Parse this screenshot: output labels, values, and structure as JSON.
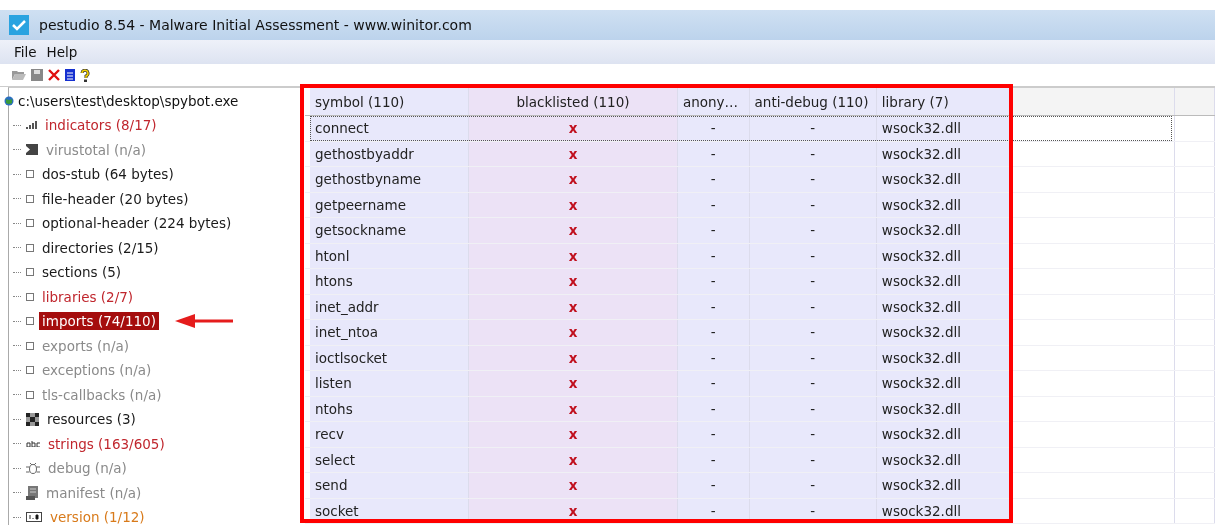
{
  "window": {
    "title": "pestudio 8.54 - Malware Initial Assessment - www.winitor.com"
  },
  "menu": [
    "File",
    "Help"
  ],
  "toolbar": [
    {
      "kind": "open"
    },
    {
      "kind": "save"
    },
    {
      "kind": "close"
    },
    {
      "kind": "clipboard"
    },
    {
      "kind": "help"
    }
  ],
  "tree": {
    "root": "c:\\users\\test\\desktop\\spybot.exe",
    "items": [
      {
        "label": "indicators (8/17)",
        "kind": "chart",
        "color": "#c0262d",
        "selected": false
      },
      {
        "label": "virustotal (n/a)",
        "kind": "virustotal",
        "color": "#8a8a8a",
        "selected": false
      },
      {
        "label": "dos-stub (64 bytes)",
        "kind": "node",
        "color": "#1a1a1a",
        "selected": false
      },
      {
        "label": "file-header (20 bytes)",
        "kind": "node",
        "color": "#1a1a1a",
        "selected": false
      },
      {
        "label": "optional-header (224 bytes)",
        "kind": "node",
        "color": "#1a1a1a",
        "selected": false
      },
      {
        "label": "directories (2/15)",
        "kind": "node",
        "color": "#1a1a1a",
        "selected": false
      },
      {
        "label": "sections (5)",
        "kind": "node",
        "color": "#1a1a1a",
        "selected": false
      },
      {
        "label": "libraries (2/7)",
        "kind": "node",
        "color": "#c0262d",
        "selected": false
      },
      {
        "label": "imports (74/110)",
        "kind": "node",
        "color": "#a50d0d",
        "selected": true
      },
      {
        "label": "exports (n/a)",
        "kind": "node",
        "color": "#8a8a8a",
        "selected": false
      },
      {
        "label": "exceptions (n/a)",
        "kind": "node",
        "color": "#8a8a8a",
        "selected": false
      },
      {
        "label": "tls-callbacks (n/a)",
        "kind": "node",
        "color": "#8a8a8a",
        "selected": false
      },
      {
        "label": "resources (3)",
        "kind": "resources",
        "color": "#1a1a1a",
        "selected": false
      },
      {
        "label": "strings (163/605)",
        "kind": "strings",
        "color": "#c0262d",
        "selected": false
      },
      {
        "label": "debug (n/a)",
        "kind": "debug",
        "color": "#8a8a8a",
        "selected": false
      },
      {
        "label": "manifest (n/a)",
        "kind": "manifest",
        "color": "#8a8a8a",
        "selected": false
      },
      {
        "label": "version (1/12)",
        "kind": "version",
        "color": "#d87a1a",
        "selected": false
      }
    ]
  },
  "table": {
    "columns": [
      "symbol (110)",
      "blacklisted (110)",
      "anony…",
      "anti-debug (110)",
      "library (7)"
    ],
    "rows": [
      {
        "symbol": "connect",
        "blacklisted": "x",
        "anonymous": "-",
        "anti_debug": "-",
        "library": "wsock32.dll",
        "selected": true
      },
      {
        "symbol": "gethostbyaddr",
        "blacklisted": "x",
        "anonymous": "-",
        "anti_debug": "-",
        "library": "wsock32.dll",
        "selected": false
      },
      {
        "symbol": "gethostbyname",
        "blacklisted": "x",
        "anonymous": "-",
        "anti_debug": "-",
        "library": "wsock32.dll",
        "selected": false
      },
      {
        "symbol": "getpeername",
        "blacklisted": "x",
        "anonymous": "-",
        "anti_debug": "-",
        "library": "wsock32.dll",
        "selected": false
      },
      {
        "symbol": "getsockname",
        "blacklisted": "x",
        "anonymous": "-",
        "anti_debug": "-",
        "library": "wsock32.dll",
        "selected": false
      },
      {
        "symbol": "htonl",
        "blacklisted": "x",
        "anonymous": "-",
        "anti_debug": "-",
        "library": "wsock32.dll",
        "selected": false
      },
      {
        "symbol": "htons",
        "blacklisted": "x",
        "anonymous": "-",
        "anti_debug": "-",
        "library": "wsock32.dll",
        "selected": false
      },
      {
        "symbol": "inet_addr",
        "blacklisted": "x",
        "anonymous": "-",
        "anti_debug": "-",
        "library": "wsock32.dll",
        "selected": false
      },
      {
        "symbol": "inet_ntoa",
        "blacklisted": "x",
        "anonymous": "-",
        "anti_debug": "-",
        "library": "wsock32.dll",
        "selected": false
      },
      {
        "symbol": "ioctlsocket",
        "blacklisted": "x",
        "anonymous": "-",
        "anti_debug": "-",
        "library": "wsock32.dll",
        "selected": false
      },
      {
        "symbol": "listen",
        "blacklisted": "x",
        "anonymous": "-",
        "anti_debug": "-",
        "library": "wsock32.dll",
        "selected": false
      },
      {
        "symbol": "ntohs",
        "blacklisted": "x",
        "anonymous": "-",
        "anti_debug": "-",
        "library": "wsock32.dll",
        "selected": false
      },
      {
        "symbol": "recv",
        "blacklisted": "x",
        "anonymous": "-",
        "anti_debug": "-",
        "library": "wsock32.dll",
        "selected": false
      },
      {
        "symbol": "select",
        "blacklisted": "x",
        "anonymous": "-",
        "anti_debug": "-",
        "library": "wsock32.dll",
        "selected": false
      },
      {
        "symbol": "send",
        "blacklisted": "x",
        "anonymous": "-",
        "anti_debug": "-",
        "library": "wsock32.dll",
        "selected": false
      },
      {
        "symbol": "socket",
        "blacklisted": "x",
        "anonymous": "-",
        "anti_debug": "-",
        "library": "wsock32.dll",
        "selected": false
      }
    ]
  }
}
